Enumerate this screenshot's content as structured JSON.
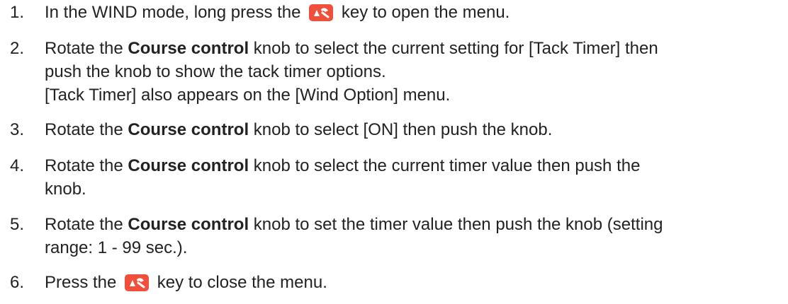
{
  "steps": [
    {
      "num": "1.",
      "pre": "In the WIND mode, long press the",
      "icon": "menu-key-icon",
      "post": "key to open the menu."
    },
    {
      "num": "2.",
      "l1_pre": "Rotate the",
      "l1_bold": "Course control",
      "l1_post": "knob to select the current setting for [Tack Timer] then",
      "l2": "push the knob to show the tack timer options.",
      "l3": "[Tack Timer] also appears on the [Wind Option] menu."
    },
    {
      "num": "3.",
      "pre": "Rotate the",
      "bold": "Course control",
      "post": "knob to select [ON] then push the knob."
    },
    {
      "num": "4.",
      "l1_pre": "Rotate the",
      "l1_bold": "Course control",
      "l1_post": "knob to select the current timer value then push the",
      "l2": "knob."
    },
    {
      "num": "5.",
      "l1_pre": "Rotate the",
      "l1_bold": "Course control",
      "l1_post": "knob to set the timer value then push the knob (setting",
      "l2": "range: 1 - 99 sec.)."
    },
    {
      "num": "6.",
      "pre": "Press the",
      "icon": "menu-key-icon",
      "post": "key to close the menu."
    }
  ],
  "icon_colors": {
    "key_bg": "#ef4f3b",
    "key_fg": "#ffffff"
  }
}
